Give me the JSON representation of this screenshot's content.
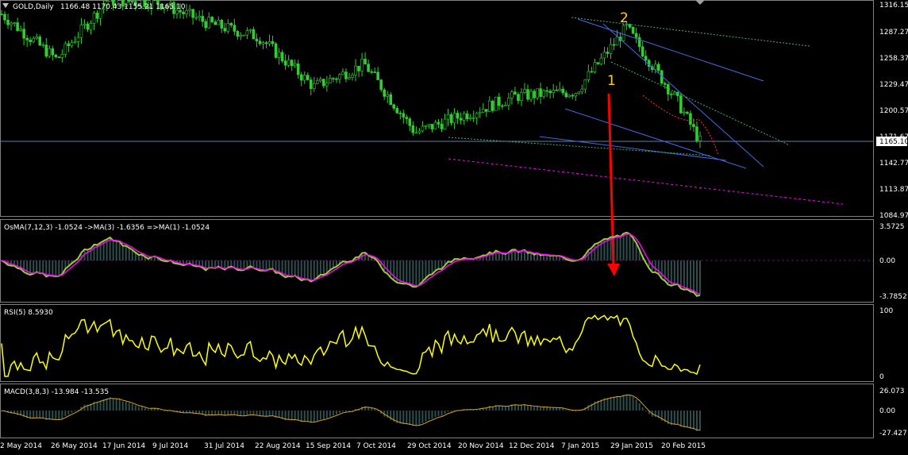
{
  "chart_window": {
    "symbol_label": "GOLD,Daily",
    "ohlc_label": "1166.48 1170.43 1155.21 1165.10",
    "current_price_label": "1165.10",
    "price_axis": [
      "1316.15",
      "1287.27",
      "1258.37",
      "1229.47",
      "1200.57",
      "1171.67",
      "1142.77",
      "1113.87",
      "1084.97"
    ],
    "wave_labels": [
      "1",
      "2"
    ]
  },
  "osma_panel": {
    "label": "OsMA(7,12,3) -1.0524  ->MA(3) -1.6356  =>MA(1) -1.0524",
    "axis": [
      "3.5725",
      "0.00",
      "-3.7852"
    ]
  },
  "rsi_panel": {
    "label": "RSI(5) 8.5930",
    "axis": [
      "100",
      "0"
    ]
  },
  "macd_panel": {
    "label": "MACD(3,8,3) -13.984 -13.535",
    "axis": [
      "26.073",
      "0.00",
      "-27.427"
    ]
  },
  "time_axis": [
    "2 May 2014",
    "26 May 2014",
    "17 Jun 2014",
    "9 Jul 2014",
    "31 Jul 2014",
    "22 Aug 2014",
    "15 Sep 2014",
    "7 Oct 2014",
    "29 Oct 2014",
    "20 Nov 2014",
    "12 Dec 2014",
    "7 Jan 2015",
    "29 Jan 2015",
    "20 Feb 2015"
  ],
  "colors": {
    "background": "#000000",
    "candles": "#32cd32",
    "trendline": "#4169e1",
    "channel_dotted": "#3cb371",
    "support_dotted": "#ff00ff",
    "arrow": "#ff0000",
    "osma_hist": "#2f4f4f",
    "osma_line": "#9acd32",
    "osma_signal": "#ff00ff",
    "rsi_line": "#ffff00",
    "macd_signal": "#daa520"
  },
  "chart_data": {
    "type": "line",
    "x": [
      "2014-05-02",
      "2014-05-26",
      "2014-06-17",
      "2014-07-09",
      "2014-07-31",
      "2014-08-22",
      "2014-09-15",
      "2014-10-07",
      "2014-10-29",
      "2014-11-20",
      "2014-12-12",
      "2015-01-07",
      "2015-01-29",
      "2015-02-20",
      "2015-03-02"
    ],
    "series": [
      {
        "name": "GOLD,Daily",
        "values": [
          1305,
          1255,
          1320,
          1318,
          1295,
          1280,
          1225,
          1250,
          1175,
          1195,
          1215,
          1220,
          1290,
          1210,
          1165.1
        ]
      }
    ],
    "ylim": [
      1084.97,
      1316.15
    ]
  }
}
